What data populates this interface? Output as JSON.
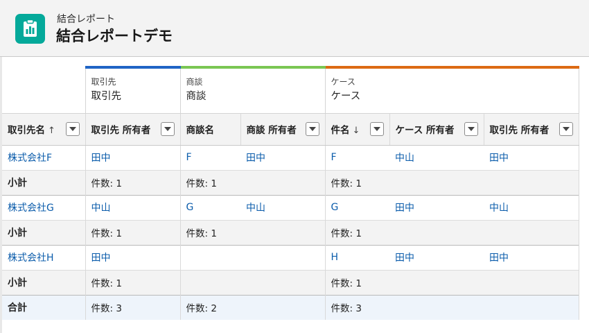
{
  "header": {
    "subtitle": "結合レポート",
    "title": "結合レポートデモ",
    "icon": "report-icon",
    "icon_color": "#04a99a"
  },
  "blocks": [
    {
      "object": "取引先",
      "name": "取引先",
      "color": "#1f64c5"
    },
    {
      "object": "商談",
      "name": "商談",
      "color": "#7bc653"
    },
    {
      "object": "ケース",
      "name": "ケース",
      "color": "#dc6a13"
    }
  ],
  "columns": {
    "account_name": "取引先名",
    "account_sort": "↑",
    "account_owner": "取引先 所有者",
    "opp_name": "商談名",
    "opp_owner": "商談 所有者",
    "case_subject": "件名",
    "case_sort": "↓",
    "case_owner": "ケース 所有者",
    "case_account_owner": "取引先 所有者"
  },
  "groups": [
    {
      "account": "株式会社F",
      "account_owner": "田中",
      "opp_name": "F",
      "opp_owner": "田中",
      "case_subject": "F",
      "case_owner": "中山",
      "case_account_owner": "田中",
      "subtotal_label": "小計",
      "acct_count": "件数: 1",
      "opp_count": "件数: 1",
      "case_count": "件数: 1"
    },
    {
      "account": "株式会社G",
      "account_owner": "中山",
      "opp_name": "G",
      "opp_owner": "中山",
      "case_subject": "G",
      "case_owner": "田中",
      "case_account_owner": "中山",
      "subtotal_label": "小計",
      "acct_count": "件数: 1",
      "opp_count": "件数: 1",
      "case_count": "件数: 1"
    },
    {
      "account": "株式会社H",
      "account_owner": "田中",
      "opp_name": "",
      "opp_owner": "",
      "case_subject": "H",
      "case_owner": "田中",
      "case_account_owner": "田中",
      "subtotal_label": "小計",
      "acct_count": "件数: 1",
      "opp_count": "",
      "case_count": "件数: 1"
    }
  ],
  "total": {
    "label": "合計",
    "acct_count": "件数: 3",
    "opp_count": "件数: 2",
    "case_count": "件数: 3"
  },
  "colors": {
    "link": "#0b5cab",
    "header_bg": "#f3f3f3",
    "total_bg": "#eef4fb"
  }
}
